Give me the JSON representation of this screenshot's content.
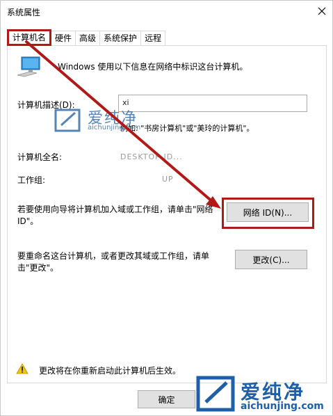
{
  "window": {
    "title": "系统属性"
  },
  "tabs": [
    {
      "label": "计算机名",
      "active": true
    },
    {
      "label": "硬件",
      "active": false
    },
    {
      "label": "高级",
      "active": false
    },
    {
      "label": "系统保护",
      "active": false
    },
    {
      "label": "远程",
      "active": false
    }
  ],
  "main": {
    "intro": "Windows 使用以下信息在网络中标识这台计算机。",
    "description_label": "计算机描述(D):",
    "description_value": "xi",
    "hint": "例如: \"书房计算机\"或\"美玲的计算机\"。",
    "fullname_label": "计算机全名:",
    "fullname_value": "DESKTOP-ID...",
    "workgroup_label": "工作组:",
    "workgroup_value": "UP",
    "network_text": "若要使用向导将计算机加入域或工作组，请单击\"网络 ID\"。",
    "network_button": "网络 ID(N)...",
    "rename_text": "要重命名这台计算机，或者更改其域或工作组，请单击\"更改\"。",
    "change_button": "更改(C)...",
    "warning": "更改将在你重新启动此计算机后生效。",
    "ok_button": "确定"
  },
  "watermark": {
    "brand": "爱纯净",
    "url": "aichunjing.com"
  },
  "colors": {
    "highlight": "#b21818",
    "watermark": "#1d5fa8",
    "button_bg": "#e1e1e1"
  },
  "icons": [
    "computer-icon",
    "warning-icon",
    "close-icon",
    "arrow-annotation"
  ]
}
